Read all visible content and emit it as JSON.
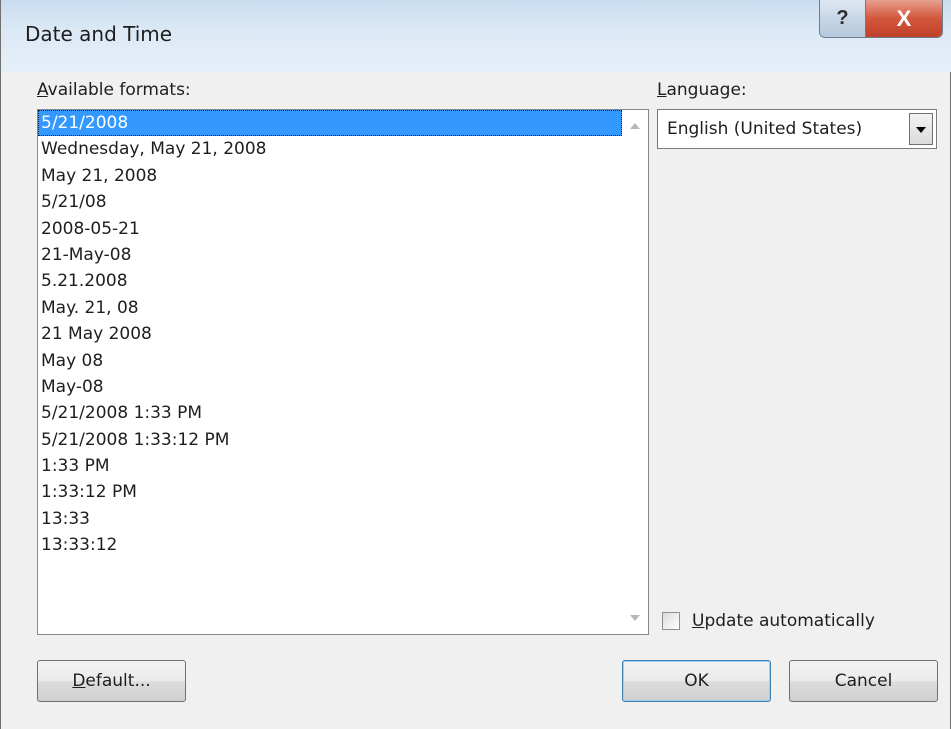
{
  "window": {
    "title": "Date and Time",
    "help_glyph": "?",
    "close_glyph": "X"
  },
  "formats": {
    "label_first": "A",
    "label_rest": "vailable formats:",
    "selected_index": 0,
    "items": [
      "5/21/2008",
      "Wednesday, May 21, 2008",
      "May 21, 2008",
      "5/21/08",
      "2008-05-21",
      "21-May-08",
      "5.21.2008",
      "May. 21, 08",
      "21 May 2008",
      "May 08",
      "May-08",
      "5/21/2008 1:33 PM",
      "5/21/2008 1:33:12 PM",
      "1:33 PM",
      "1:33:12 PM",
      "13:33",
      "13:33:12"
    ]
  },
  "language": {
    "label_first": "L",
    "label_rest": "anguage:",
    "value": "English (United States)"
  },
  "update": {
    "label_first": "U",
    "label_rest": "pdate automatically",
    "checked": false
  },
  "buttons": {
    "default_first": "D",
    "default_rest": "efault...",
    "ok": "OK",
    "cancel": "Cancel"
  },
  "colors": {
    "selection": "#3399ff",
    "close_button": "#c0412a"
  }
}
